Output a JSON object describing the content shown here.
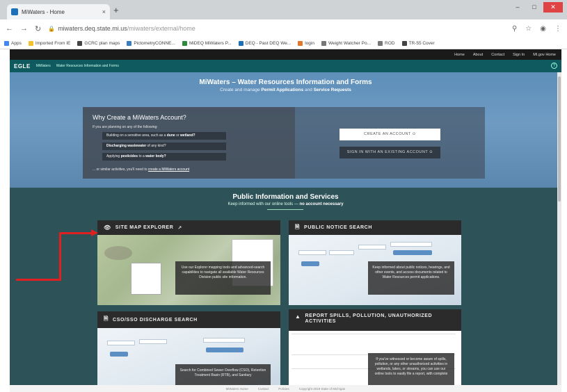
{
  "browser": {
    "tab_title": "MiWaters - Home",
    "tab_close": "×",
    "new_tab": "+",
    "url_host": "miwaters.deq.state.mi.us",
    "url_path": "/miwaters/external/home",
    "bookmarks": [
      {
        "label": "Apps",
        "color": "#4285f4"
      },
      {
        "label": "Imported From IE",
        "color": "#f2c230"
      },
      {
        "label": "GCRC plan maps",
        "color": "#444444"
      },
      {
        "label": "PictometryCONNE...",
        "color": "#3b7bbf"
      },
      {
        "label": "MiDEQ MiWaters P...",
        "color": "#2e8b3d"
      },
      {
        "label": "DEQ - Past DEQ We...",
        "color": "#1d6fb8"
      },
      {
        "label": "login",
        "color": "#e2762b"
      },
      {
        "label": "Weight Watcher Po...",
        "color": "#777777"
      },
      {
        "label": "ROD",
        "color": "#777777"
      },
      {
        "label": "TR-55 Cover",
        "color": "#444444"
      }
    ]
  },
  "site_nav": {
    "items": [
      "Home",
      "About",
      "Contact",
      "Sign In",
      "MI.gov Home"
    ]
  },
  "egle_bar": {
    "logo": "EGLE",
    "app": "MiWaters",
    "section": "Water Resources Information and Forms"
  },
  "hero": {
    "title": "MiWaters – Water Resources Information and Forms",
    "sub_prefix": "Create and manage",
    "sub_bold1": "Permit Applications",
    "sub_and": "and",
    "sub_bold2": "Service Requests"
  },
  "account": {
    "title": "Why Create a MiWaters Account?",
    "intro": "If you are planning on any of the following:",
    "items": [
      {
        "pre": "Building on a sensitive area, such as a",
        "b1": "dune",
        "mid": "or",
        "b2": "wetland?"
      },
      {
        "b1": "Discharging wastewater",
        "post": "of any kind?"
      },
      {
        "pre": "Applying",
        "b1": "pesticides",
        "mid": "to a",
        "b2": "water body?"
      }
    ],
    "foot_prefix": "... or similar activities, you'll need to",
    "foot_link": "create a MiWaters account",
    "create_button": "CREATE AN ACCOUNT",
    "signin_button": "SIGN IN WITH AN EXISTING ACCOUNT"
  },
  "public": {
    "title": "Public Information and Services",
    "sub_prefix": "Keep informed with our online tools —",
    "sub_bold": "no account necessary"
  },
  "cards": {
    "site_map": {
      "title": "SITE MAP EXPLORER",
      "desc": "Use our Explorer mapping tools and advanced-search capabilities to navigate all available Water Resources Division public site information."
    },
    "public_notice": {
      "title": "PUBLIC NOTICE SEARCH",
      "desc": "Keep informed about public notices, hearings, and other events, and access documents related to Water Resources permit applications."
    },
    "cso": {
      "title": "CSO/SSO DISCHARGE SEARCH",
      "desc": "Search for Combined Sewer Overflow (CSO), Retention Treatment Basin (RTB), and Sanitary"
    },
    "report": {
      "title": "REPORT SPILLS, POLLUTION, UNAUTHORIZED ACTIVITIES",
      "desc": "If you've witnessed or become aware of spills, pollution, or any other unauthorized activities in wetlands, lakes, or streams, you can use our online tools to easily file a report, with complete"
    }
  },
  "footer": {
    "items": [
      "MiWaters Home",
      "Contact",
      "Policies",
      "Copyright 2019 State of Michigan"
    ]
  },
  "colors": {
    "hero_blue": "#6f9bc3",
    "egle_teal": "#0e5a5f",
    "public_teal": "#2d5257",
    "arrow_red": "#e02020"
  }
}
